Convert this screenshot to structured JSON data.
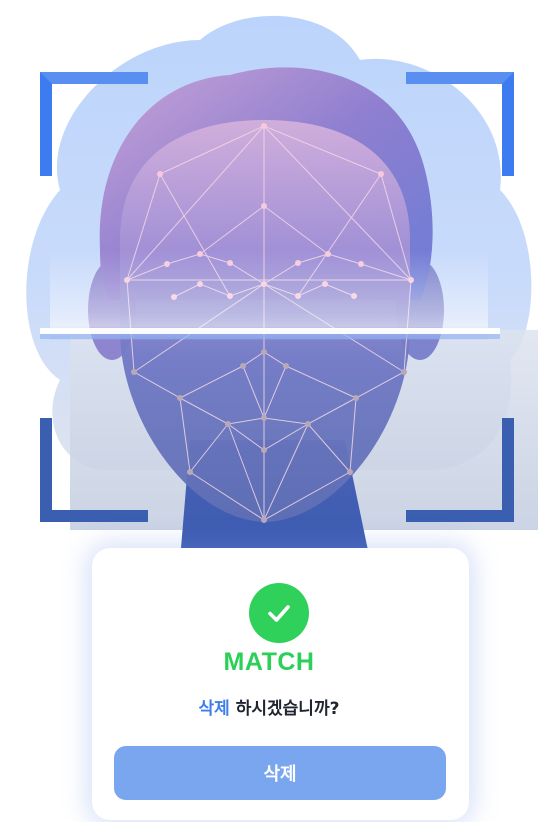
{
  "result": {
    "status": "MATCH",
    "status_color": "#2ccf57",
    "icon": "check-circle-icon"
  },
  "prompt": {
    "highlight": "삭제",
    "rest": " 하시겠습니까?",
    "highlight_color": "#3f7fe8"
  },
  "actions": {
    "delete_label": "삭제",
    "delete_color": "#79a6ee"
  },
  "illustration": {
    "name": "face-scan-illustration",
    "frame_color": "#3d7cf0"
  }
}
